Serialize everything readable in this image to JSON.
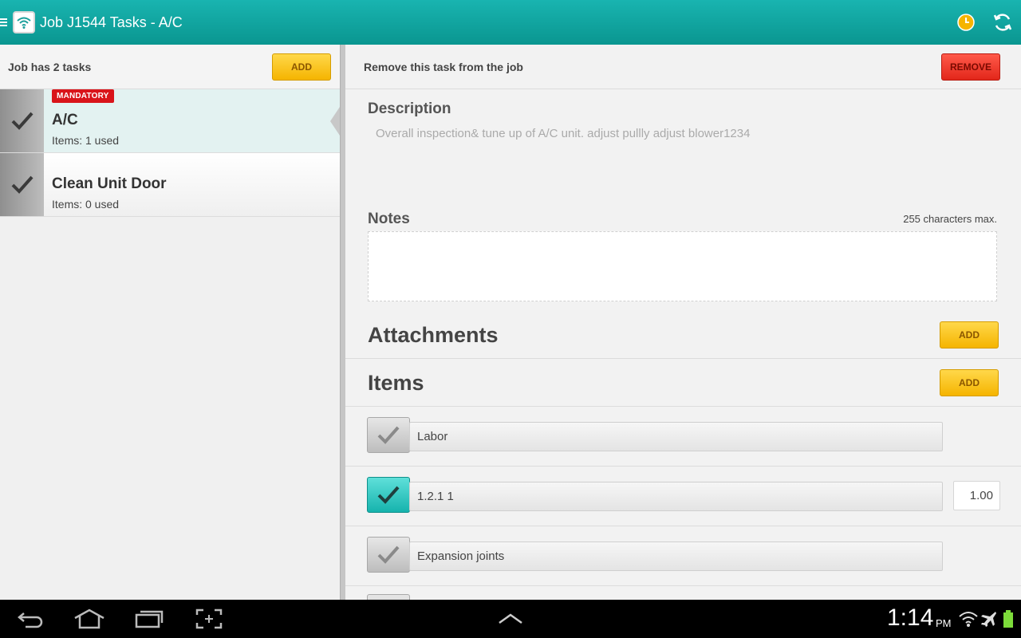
{
  "colors": {
    "accent": "#0fa7a1",
    "yellow_button": "#f5b400",
    "red_button": "#e2261a",
    "badge_red": "#d9141a"
  },
  "action_bar": {
    "title": "Job J1544 Tasks - A/C",
    "icons": {
      "app": "wifi-app-icon",
      "clock": "clock-icon",
      "sync": "sync-icon",
      "menu": "hamburger-icon"
    }
  },
  "left_pane": {
    "header_label": "Job has 2 tasks",
    "add_label": "ADD",
    "tasks": [
      {
        "badge": "MANDATORY",
        "name": "A/C",
        "meta": "Items: 1 used",
        "selected": true
      },
      {
        "badge": "",
        "name": "Clean Unit Door",
        "meta": "Items: 0 used",
        "selected": false
      }
    ]
  },
  "right_pane": {
    "remove_prompt": "Remove this task from the job",
    "remove_label": "REMOVE",
    "description_title": "Description",
    "description_text": "Overall inspection& tune up of A/C unit.  adjust pullly adjust blower1234",
    "notes_title": "Notes",
    "notes_max": "255 characters max.",
    "notes_value": "",
    "attachments_title": "Attachments",
    "attachments_add": "ADD",
    "items_title": "Items",
    "items_add": "ADD",
    "items": [
      {
        "label": "Labor",
        "checked": false,
        "qty": ""
      },
      {
        "label": "1.2.1 1",
        "checked": true,
        "qty": "1.00"
      },
      {
        "label": "Expansion joints",
        "checked": false,
        "qty": ""
      }
    ]
  },
  "system_bar": {
    "time": "1:14",
    "ampm": "PM",
    "icons": [
      "back-icon",
      "home-icon",
      "recent-apps-icon",
      "screenshot-icon",
      "up-chevron-icon",
      "wifi-icon",
      "airplane-icon",
      "battery-icon"
    ]
  }
}
